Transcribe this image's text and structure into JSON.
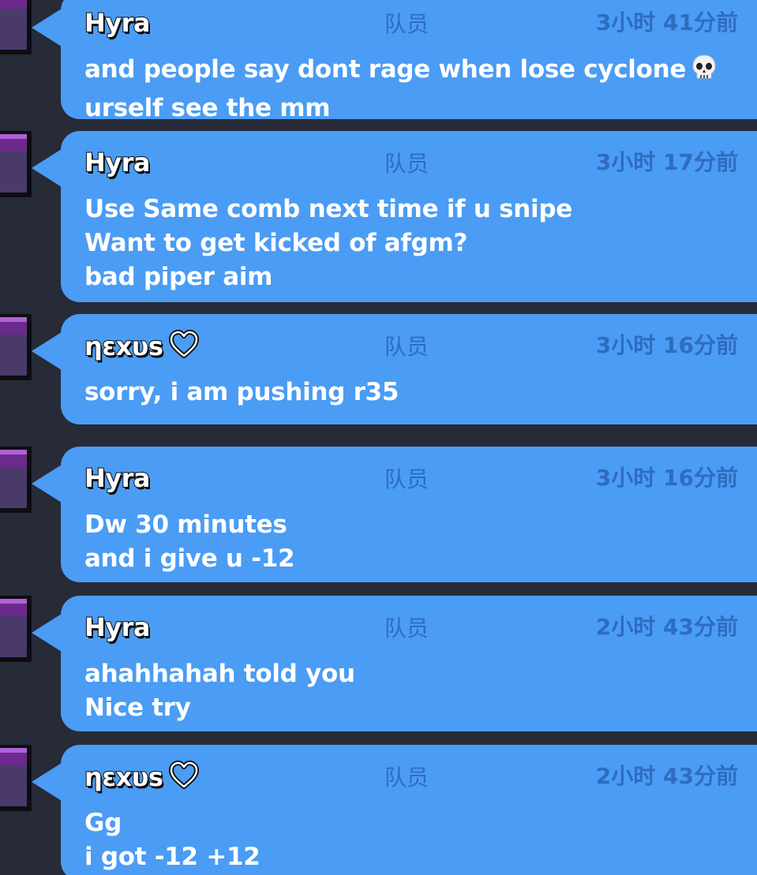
{
  "messages": [
    {
      "sender": "Hyra",
      "role": "队员",
      "time": "3小时 41分前",
      "lines": [
        "and people say dont rage when lose cyclone",
        "urself see the mm"
      ],
      "emoji": "skull-icon"
    },
    {
      "sender": "Hyra",
      "role": "队员",
      "time": "3小时 17分前",
      "lines": [
        "Use Same comb next time if u snipe",
        "Want to get kicked of afgm?",
        "bad piper aim"
      ]
    },
    {
      "sender": "ηεxυs",
      "sender_icon": "heart-outline-icon",
      "role": "队员",
      "time": "3小时 16分前",
      "lines": [
        "sorry, i am pushing r35"
      ]
    },
    {
      "sender": "Hyra",
      "role": "队员",
      "time": "3小时 16分前",
      "lines": [
        "Dw 30 minutes",
        "and i give u -12"
      ]
    },
    {
      "sender": "Hyra",
      "role": "队员",
      "time": "2小时 43分前",
      "lines": [
        "ahahhahah told you",
        "Nice try"
      ]
    },
    {
      "sender": "ηεxυs",
      "sender_icon": "heart-outline-icon",
      "role": "队员",
      "time": "2小时 43分前",
      "lines": [
        "Gg",
        "i got -12 +12"
      ]
    }
  ],
  "colors": {
    "background": "#272a37",
    "bubble": "#4a9cf4",
    "meta_text": "#2f6cc0",
    "message_text": "#ffffff"
  }
}
